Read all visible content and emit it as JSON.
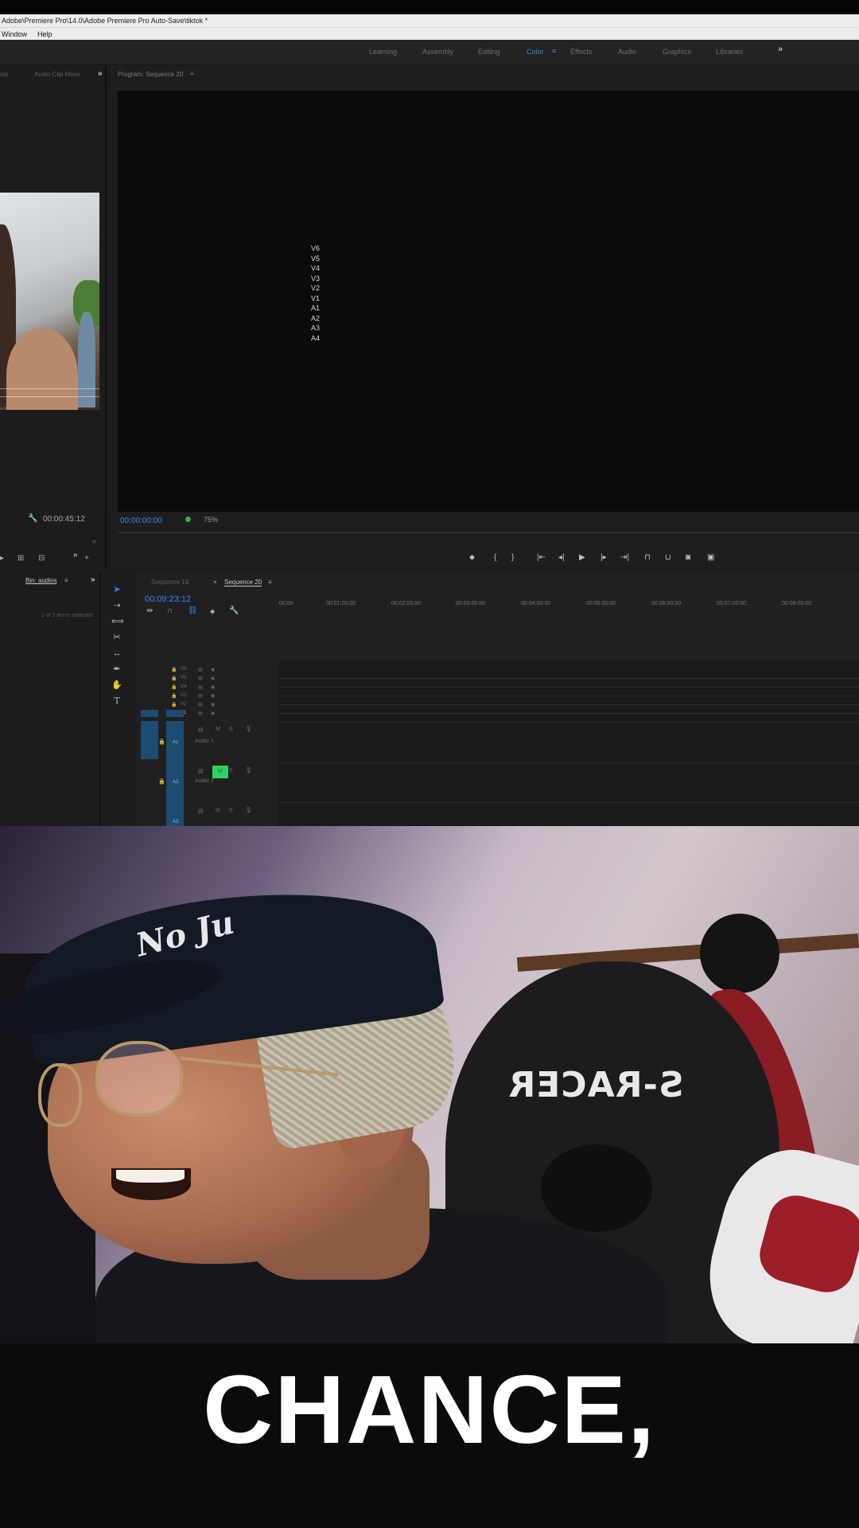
{
  "window": {
    "title": "Adobe\\Premiere Pro\\14.0\\Adobe Premiere Pro Auto-Save\\tiktok *",
    "menu": [
      "Window",
      "Help"
    ]
  },
  "workspaces": {
    "items": [
      "Learning",
      "Assembly",
      "Editing",
      "Color",
      "Effects",
      "Audio",
      "Graphics",
      "Libraries"
    ],
    "active": "Color",
    "menu_icon": "hamburger-icon",
    "more_icon": "double-chevron-icon"
  },
  "source_panel": {
    "tab_left": "ots",
    "tab_audio_mixer": "Audio Clip Mixer",
    "more_icon": "double-chevron-icon",
    "timecode": "00:00:45:12"
  },
  "program_monitor": {
    "title": "Program: Sequence 20",
    "track_overlay": [
      "V6",
      "V5",
      "V4",
      "V3",
      "V2",
      "V1",
      "A1",
      "A2",
      "A3",
      "A4"
    ],
    "timecode": "00:00:00:00",
    "zoom": "75%"
  },
  "project_panel": {
    "bin_tab": "Bin: audios",
    "bin_info": "1 of 2 items selected"
  },
  "timeline": {
    "tabs": [
      "Sequence 19",
      "Sequence 20"
    ],
    "active_tab": "Sequence 20",
    "timecode": "00:09:23:12",
    "ruler": [
      "00:00",
      "00:01:00:00",
      "00:02:00:00",
      "00:03:00:00",
      "00:04:00:00",
      "00:05:00:00",
      "00:06:00:00",
      "00:07:00:00",
      "00:08:00:00"
    ],
    "video_tracks": [
      "V6",
      "V5",
      "V4",
      "V3",
      "V2",
      "V1"
    ],
    "audio_tracks": [
      {
        "name": "A1",
        "label": "Audio 1"
      },
      {
        "name": "A2",
        "label": "Audio 2"
      },
      {
        "name": "A3",
        "label": ""
      }
    ],
    "mute_solo": [
      "M",
      "S"
    ]
  },
  "webcam": {
    "chair_logo": "S-RACER",
    "cap_logo": "No Ju"
  },
  "caption": {
    "text": "CHANCE,"
  },
  "colors": {
    "accent_blue": "#2d8ceb",
    "active_green": "#2fd160",
    "caption": "#ffffff"
  }
}
